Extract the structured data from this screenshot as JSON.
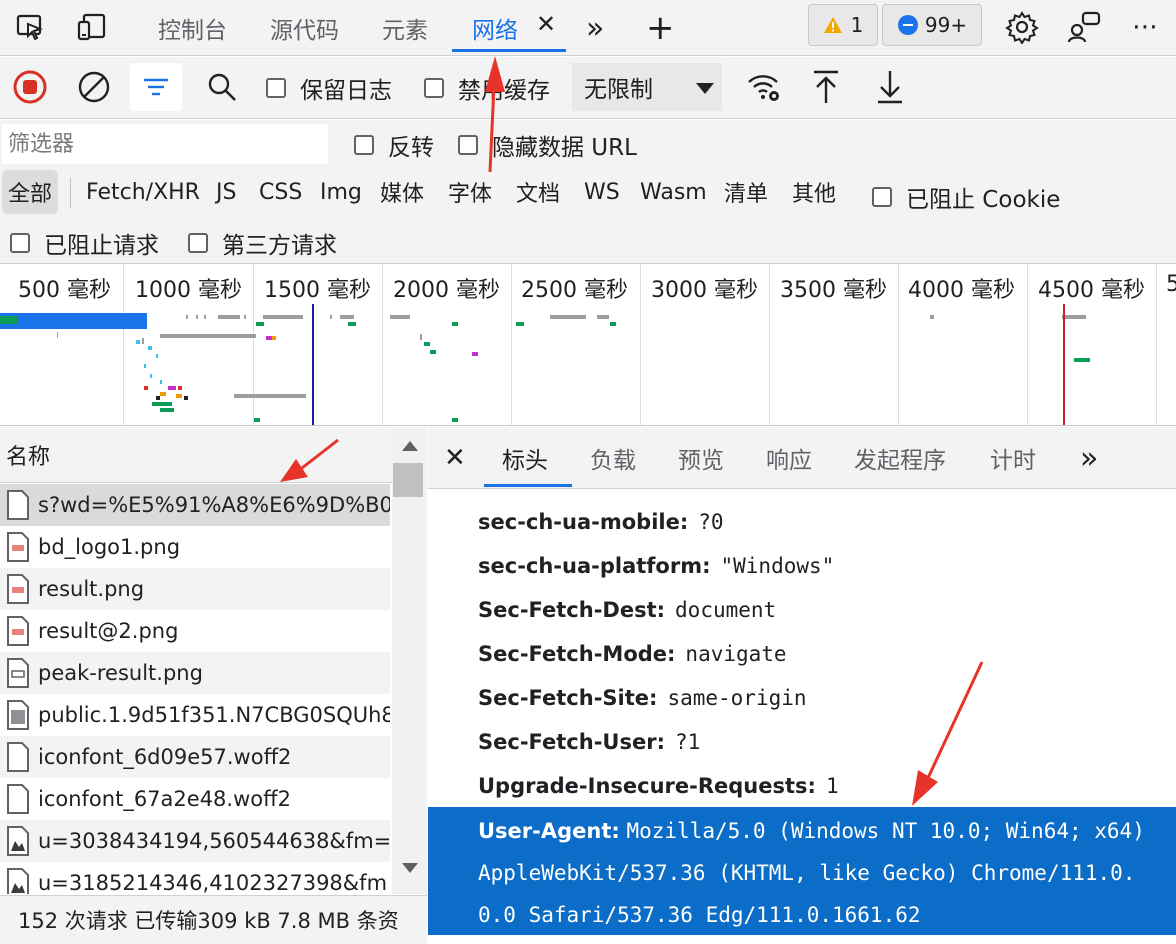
{
  "colors": {
    "accent": "#1a73e8",
    "annotation_arrow": "#e8332b",
    "selected_header_bg": "#0b6dc7"
  },
  "tabs": {
    "console": "控制台",
    "sources": "源代码",
    "elements": "元素",
    "network": "网络",
    "more": "»",
    "add": "+"
  },
  "badges": {
    "warnings": "1",
    "messages": "99+"
  },
  "toolbar": {
    "preserve_log": "保留日志",
    "disable_cache": "禁用缓存",
    "throttle": "无限制"
  },
  "filter": {
    "placeholder": "筛选器",
    "invert": "反转",
    "hide_data_urls": "隐藏数据 URL"
  },
  "types": [
    "全部",
    "Fetch/XHR",
    "JS",
    "CSS",
    "Img",
    "媒体",
    "字体",
    "文档",
    "WS",
    "Wasm",
    "清单",
    "其他"
  ],
  "blocked_cookies": "已阻止 Cookie",
  "blocked_requests": "已阻止请求",
  "third_party": "第三方请求",
  "timeline_ticks": [
    "500 毫秒",
    "1000 毫秒",
    "1500 毫秒",
    "2000 毫秒",
    "2500 毫秒",
    "3000 毫秒",
    "3500 毫秒",
    "4000 毫秒",
    "4500 毫秒",
    "5"
  ],
  "request_list": {
    "header": "名称",
    "rows": [
      "s?wd=%E5%91%A8%E6%9D%B0",
      "bd_logo1.png",
      "result.png",
      "result@2.png",
      "peak-result.png",
      "public.1.9d51f351.N7CBG0SQUh8",
      "iconfont_6d09e57.woff2",
      "iconfont_67a2e48.woff2",
      "u=3038434194,560544638&fm=5",
      "u=3185214346,4102327398&fm"
    ],
    "status": "152 次请求  已传输309 kB  7.8 MB 条资"
  },
  "detail_tabs": [
    "标头",
    "负载",
    "预览",
    "响应",
    "发起程序",
    "计时",
    "»"
  ],
  "headers": [
    {
      "name": "sec-ch-ua-mobile:",
      "value": "?0"
    },
    {
      "name": "sec-ch-ua-platform:",
      "value": "\"Windows\""
    },
    {
      "name": "Sec-Fetch-Dest:",
      "value": "document"
    },
    {
      "name": "Sec-Fetch-Mode:",
      "value": "navigate"
    },
    {
      "name": "Sec-Fetch-Site:",
      "value": "same-origin"
    },
    {
      "name": "Sec-Fetch-User:",
      "value": "?1"
    },
    {
      "name": "Upgrade-Insecure-Requests:",
      "value": "1"
    }
  ],
  "user_agent": {
    "name": "User-Agent:",
    "line1": "Mozilla/5.0 (Windows NT 10.0; Win64; x64)",
    "line2": "AppleWebKit/537.36 (KHTML, like Gecko) Chrome/111.0.",
    "line3": "0.0 Safari/537.36 Edg/111.0.1661.62"
  }
}
